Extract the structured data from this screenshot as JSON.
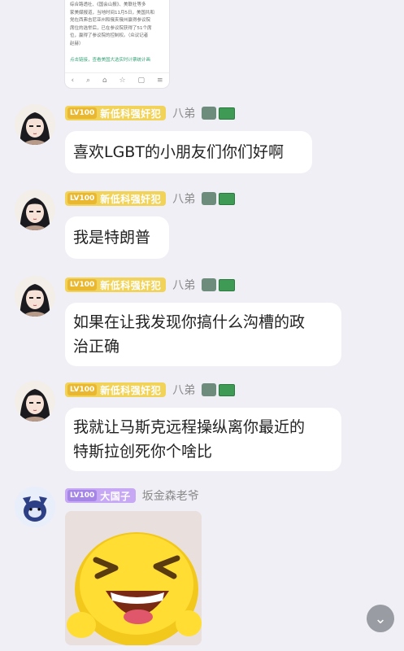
{
  "shared_card": {
    "lines": [
      "综合路透社、《国会山报》、美联社等多",
      "家美媒报道，当地时间11月5日，美国共和",
      "党在西弗吉尼亚州和俄亥俄州赢得参议院",
      "席位的选举后，已在参议院获得了51个席",
      "位，赢得了参议院的控制权。（众议记者",
      "赵赫）"
    ],
    "link_text": "点击链接，查看美国大选实时计票统计画",
    "nav_icons": [
      "back-icon",
      "search-icon",
      "home-icon",
      "bookmark-icon",
      "tabs-icon",
      "menu-icon"
    ]
  },
  "messages": [
    {
      "level": "LV100",
      "title": "新低科强奸犯",
      "user": "八弟",
      "text_lines": [
        "喜欢LGBT的小朋友们你们好啊"
      ]
    },
    {
      "level": "LV100",
      "title": "新低科强奸犯",
      "user": "八弟",
      "text_lines": [
        "我是特朗普"
      ]
    },
    {
      "level": "LV100",
      "title": "新低科强奸犯",
      "user": "八弟",
      "text_lines": [
        "如果在让我发现你搞什么沟槽的政",
        "治正确"
      ]
    },
    {
      "level": "LV100",
      "title": "新低科强奸犯",
      "user": "八弟",
      "text_lines": [
        "我就让马斯克远程操纵离你最近的",
        "特斯拉创死你个啥比"
      ]
    },
    {
      "level": "LV100",
      "title": "大国子",
      "user": "坂金森老爷"
    }
  ],
  "colors": {
    "badge_gold": "#f2d35a",
    "badge_purple": "#c6a8f4",
    "bg": "#efeff5"
  }
}
